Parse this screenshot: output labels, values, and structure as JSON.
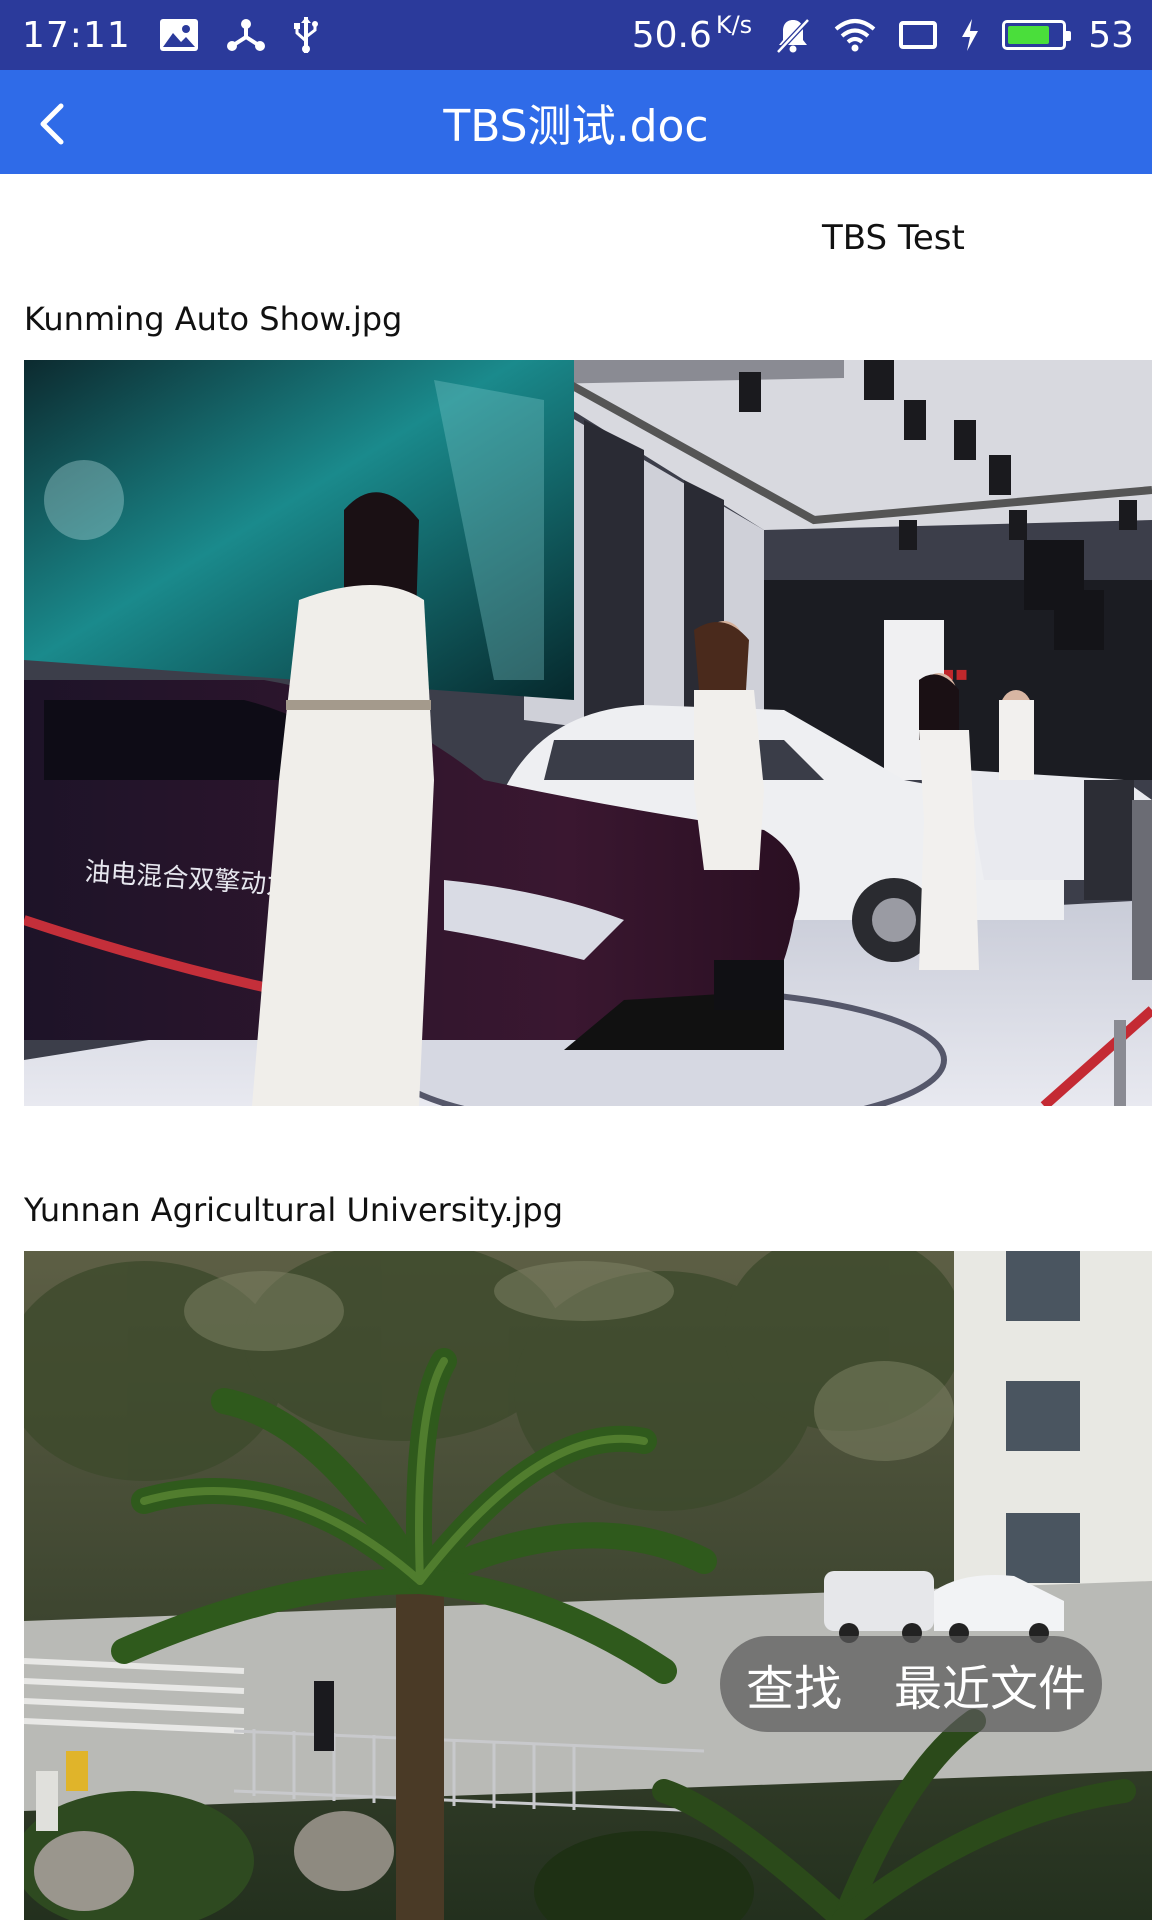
{
  "status_bar": {
    "time": "17:11",
    "network_speed": "50.6",
    "network_speed_unit": "K/s",
    "battery_level": "53",
    "icons": [
      "image-icon",
      "share-icon",
      "usb-icon",
      "mute-icon",
      "wifi-icon",
      "screen-icon",
      "charging-icon",
      "battery-icon"
    ],
    "battery_fill_color": "#4ade3b",
    "background_color": "#2b3a9b"
  },
  "app_bar": {
    "title": "TBS测试.doc",
    "back_icon": "chevron-left-icon",
    "background_color": "#2f6be8"
  },
  "document": {
    "heading": "TBS Test",
    "images": [
      {
        "caption": "Kunming Auto Show.jpg"
      },
      {
        "caption": "Yunnan Agricultural University.jpg"
      }
    ]
  },
  "floating_menu": {
    "find_label": "查找",
    "recent_files_label": "最近文件"
  }
}
